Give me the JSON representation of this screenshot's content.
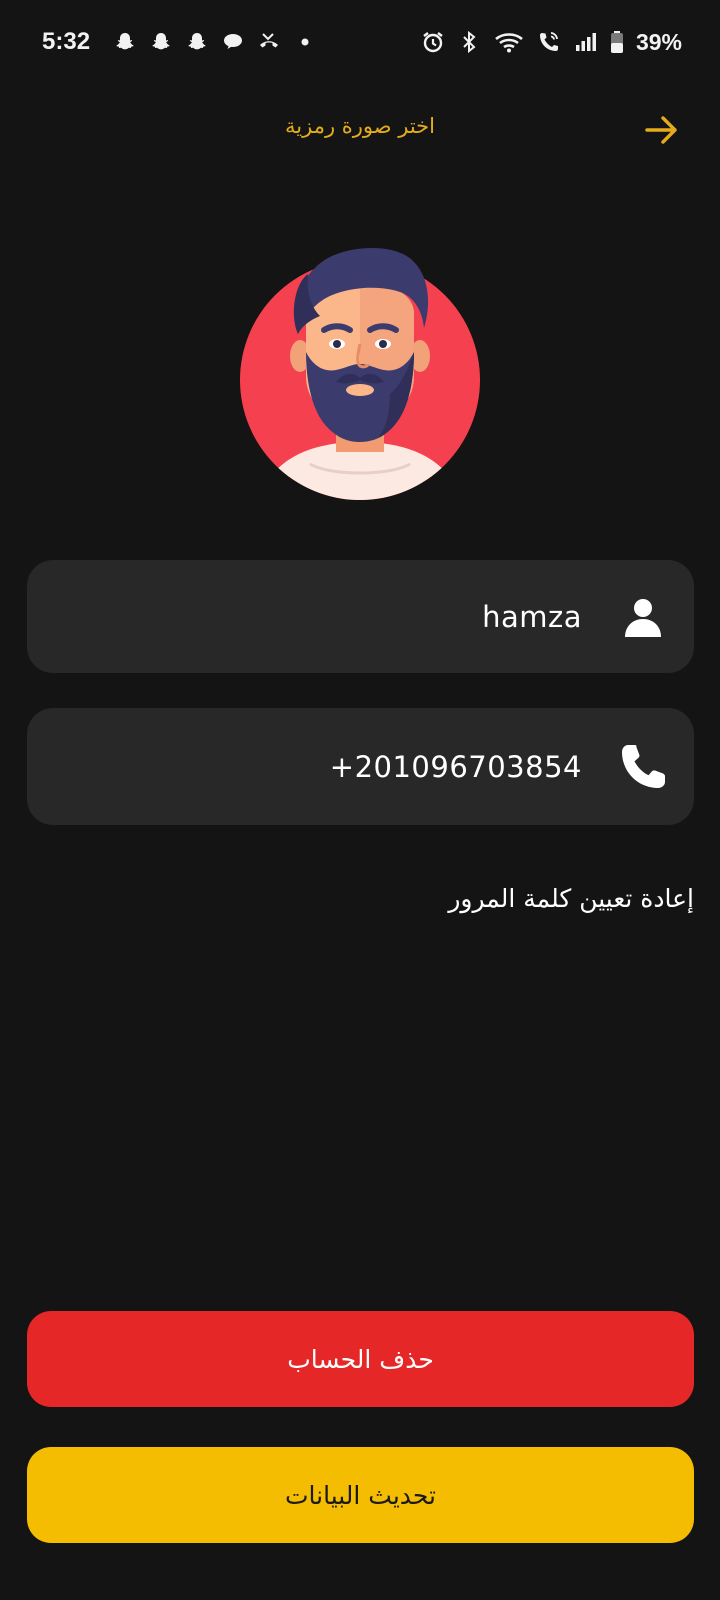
{
  "status_bar": {
    "time": "5:32",
    "battery": "39%",
    "icons_left": [
      "snapchat-icon",
      "snapchat-icon",
      "snapchat-icon",
      "chat-bubble-icon",
      "missed-call-icon",
      "dot-icon"
    ],
    "icons_right": [
      "alarm-icon",
      "bluetooth-icon",
      "wifi-icon",
      "wifi-calling-icon",
      "signal-icon",
      "battery-icon"
    ]
  },
  "header": {
    "title": "اختر صورة رمزية",
    "back_icon": "arrow-right-icon"
  },
  "profile": {
    "avatar_icon": "bearded-man-avatar",
    "name": "hamza",
    "phone": "+201096703854",
    "name_icon": "person-icon",
    "phone_icon": "phone-icon"
  },
  "links": {
    "reset_password": "إعادة تعيين كلمة المرور"
  },
  "buttons": {
    "delete_account": "حذف الحساب",
    "update_data": "تحديث البيانات"
  },
  "colors": {
    "background": "#141414",
    "field": "#272827",
    "accent": "#e4ac1d",
    "delete": "#e52727",
    "update": "#f5bd02",
    "avatar_bg": "#f5414f"
  }
}
